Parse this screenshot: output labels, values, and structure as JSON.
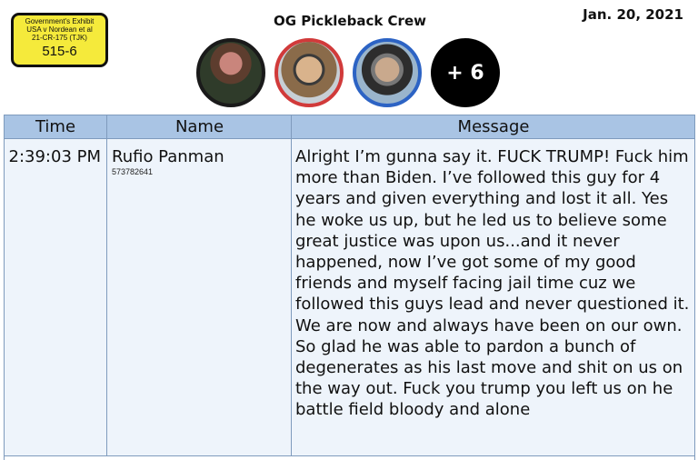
{
  "exhibit": {
    "line1": "Government's Exhibit",
    "line2": "USA v Nordean et al",
    "line3": "21-CR-175 (TJK)",
    "number": "515-6"
  },
  "header": {
    "group_title": "OG Pickleback Crew",
    "date": "Jan. 20, 2021",
    "participants": [
      {
        "icon": "avatar-photo",
        "ring_color": "#1a1a1a"
      },
      {
        "icon": "avatar-photo",
        "ring_color": "#d13a3a"
      },
      {
        "icon": "avatar-photo",
        "ring_color": "#2c63c4"
      }
    ],
    "more_count": "+ 6"
  },
  "table": {
    "columns": [
      "Time",
      "Name",
      "Message"
    ],
    "rows": [
      {
        "time": "2:39:03 PM",
        "name": "Rufio Panman",
        "id": "573782641",
        "message": "Alright I’m gunna say it.  FUCK TRUMP! Fuck him more than Biden.  I’ve followed this guy for 4 years and given everything and lost it all. Yes he woke us up, but he led us to believe some great justice was upon us...and it never happened, now I’ve got some of my good friends and myself facing jail time cuz we followed this guys lead and never questioned it.  We are now and always have been on our own.  So glad he was able to pardon a bunch of degenerates as his last move and shit on us on the way out.  Fuck you trump you left us on he battle field bloody and alone"
      }
    ]
  }
}
